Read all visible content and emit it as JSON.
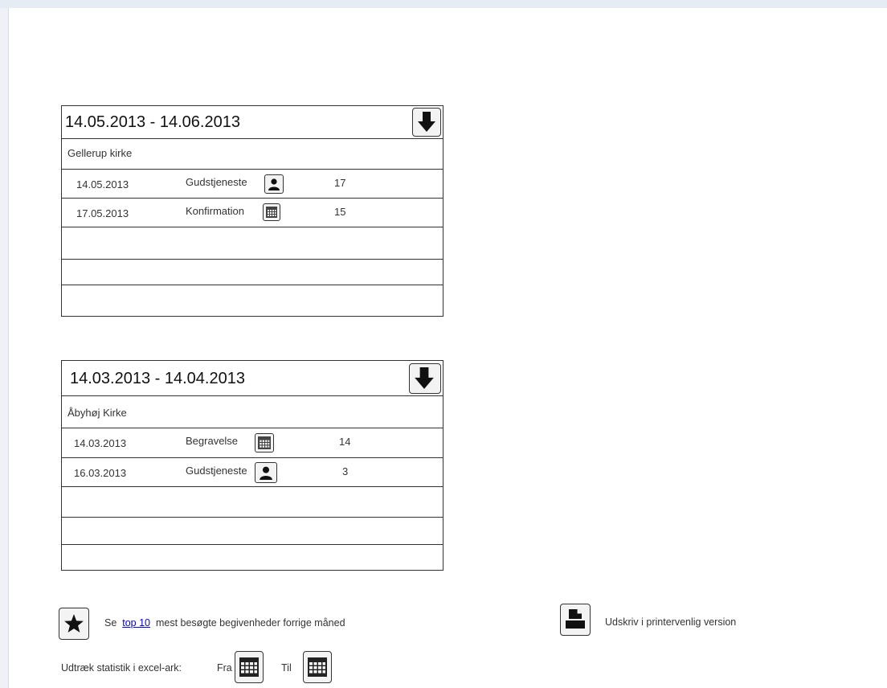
{
  "panels": [
    {
      "date_range": "14.05.2013 - 14.06.2013",
      "church": "Gellerup kirke",
      "events": [
        {
          "date": "14.05.2013",
          "type": "Gudstjeneste",
          "icon": "person-icon",
          "count": "17"
        },
        {
          "date": "17.05.2013",
          "type": "Konfirmation",
          "icon": "calendar-icon",
          "count": "15"
        }
      ],
      "download_icon": "download-arrow-icon"
    },
    {
      "date_range": "14.03.2013 - 14.04.2013",
      "church": "Åbyhøj Kirke",
      "events": [
        {
          "date": "14.03.2013",
          "type": "Begravelse",
          "icon": "calendar-icon",
          "count": "14"
        },
        {
          "date": "16.03.2013",
          "type": "Gudstjeneste",
          "icon": "person-icon",
          "count": "3"
        }
      ],
      "download_icon": "download-arrow-icon"
    }
  ],
  "top10": {
    "prefix": "Se",
    "link": "top 10",
    "suffix": "mest besøgte begivenheder forrige måned",
    "icon": "star-icon"
  },
  "export": {
    "label": "Udtræk statistik i excel-ark:",
    "from": "Fra",
    "to": "Til",
    "icon": "calendar-icon"
  },
  "print": {
    "label": "Udskriv i printervenlig version",
    "icon": "printer-icon"
  }
}
